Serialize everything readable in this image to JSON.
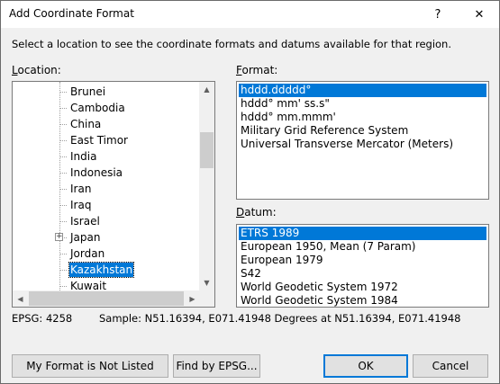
{
  "window": {
    "title": "Add Coordinate Format",
    "help_glyph": "?",
    "close_glyph": "✕"
  },
  "instruction": "Select a location to see the coordinate formats and datums available for that region.",
  "location": {
    "label_mnemonic": "L",
    "label_rest": "ocation:",
    "items": [
      {
        "label": "Brunei",
        "expandable": false,
        "selected": false
      },
      {
        "label": "Cambodia",
        "expandable": false,
        "selected": false
      },
      {
        "label": "China",
        "expandable": false,
        "selected": false
      },
      {
        "label": "East Timor",
        "expandable": false,
        "selected": false
      },
      {
        "label": "India",
        "expandable": false,
        "selected": false
      },
      {
        "label": "Indonesia",
        "expandable": false,
        "selected": false
      },
      {
        "label": "Iran",
        "expandable": false,
        "selected": false
      },
      {
        "label": "Iraq",
        "expandable": false,
        "selected": false
      },
      {
        "label": "Israel",
        "expandable": false,
        "selected": false
      },
      {
        "label": "Japan",
        "expandable": true,
        "selected": false
      },
      {
        "label": "Jordan",
        "expandable": false,
        "selected": false
      },
      {
        "label": "Kazakhstan",
        "expandable": false,
        "selected": true
      },
      {
        "label": "Kuwait",
        "expandable": false,
        "selected": false
      }
    ],
    "expander_glyph": "+",
    "scroll_up": "▲",
    "scroll_down": "▼",
    "scroll_left": "◀",
    "scroll_right": "▶"
  },
  "format": {
    "label_mnemonic": "F",
    "label_rest": "ormat:",
    "items": [
      {
        "label": "hddd.ddddd°",
        "selected": true
      },
      {
        "label": "hddd° mm' ss.s\"",
        "selected": false
      },
      {
        "label": "hddd° mm.mmm'",
        "selected": false
      },
      {
        "label": "Military Grid Reference System",
        "selected": false
      },
      {
        "label": "Universal Transverse Mercator (Meters)",
        "selected": false
      }
    ]
  },
  "datum": {
    "label_mnemonic": "D",
    "label_rest": "atum:",
    "items": [
      {
        "label": "ETRS 1989",
        "selected": true
      },
      {
        "label": "European 1950, Mean (7 Param)",
        "selected": false
      },
      {
        "label": "European 1979",
        "selected": false
      },
      {
        "label": "S42",
        "selected": false
      },
      {
        "label": "World Geodetic System 1972",
        "selected": false
      },
      {
        "label": "World Geodetic System 1984",
        "selected": false
      }
    ]
  },
  "info": {
    "epsg": "EPSG: 4258",
    "sample": "Sample: N51.16394, E071.41948 Degrees at N51.16394, E071.41948"
  },
  "buttons": {
    "not_listed": "My Format is Not Listed",
    "find_epsg": "Find by EPSG...",
    "ok": "OK",
    "cancel": "Cancel"
  },
  "colors": {
    "selection": "#0078d7",
    "dialog_bg": "#f0f0f0"
  }
}
